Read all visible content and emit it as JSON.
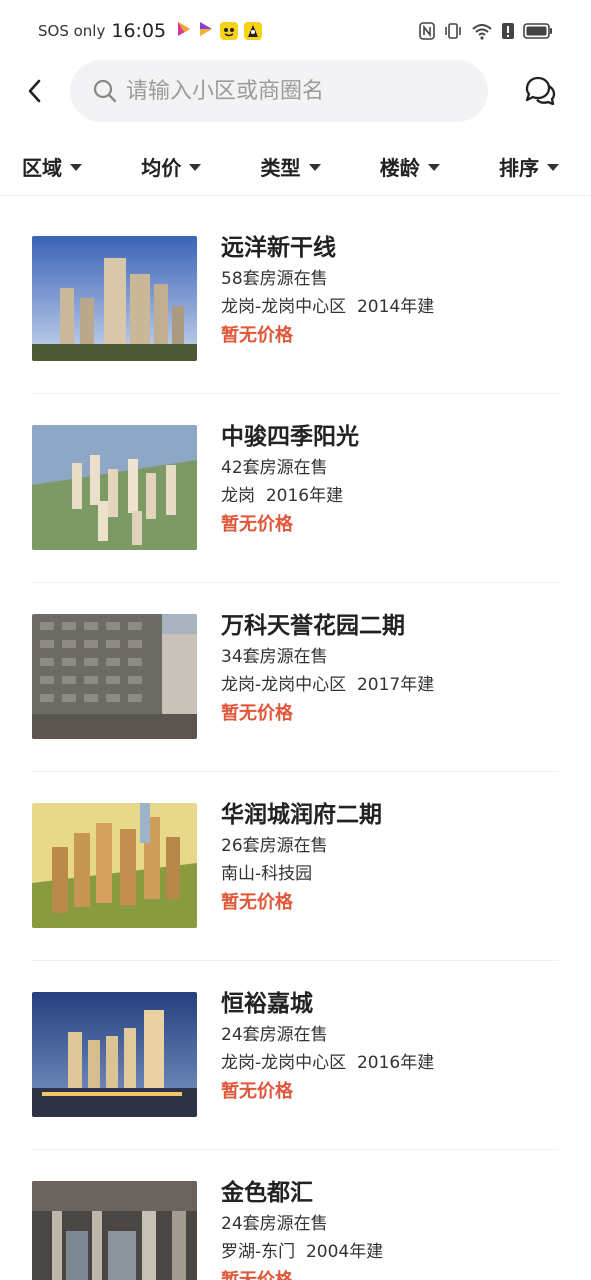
{
  "status": {
    "carrier": "SOS only",
    "time": "16:05"
  },
  "header": {
    "search_placeholder": "请输入小区或商圈名"
  },
  "filters": [
    {
      "label": "区域"
    },
    {
      "label": "均价"
    },
    {
      "label": "类型"
    },
    {
      "label": "楼龄"
    },
    {
      "label": "排序"
    }
  ],
  "listings": [
    {
      "name": "远洋新干线",
      "count": "58套房源在售",
      "location": "龙岗-龙岗中心区",
      "year": "2014年建",
      "price": "暂无价格"
    },
    {
      "name": "中骏四季阳光",
      "count": "42套房源在售",
      "location": "龙岗",
      "year": "2016年建",
      "price": "暂无价格"
    },
    {
      "name": "万科天誉花园二期",
      "count": "34套房源在售",
      "location": "龙岗-龙岗中心区",
      "year": "2017年建",
      "price": "暂无价格"
    },
    {
      "name": "华润城润府二期",
      "count": "26套房源在售",
      "location": "南山-科技园",
      "year": "",
      "price": "暂无价格"
    },
    {
      "name": "恒裕嘉城",
      "count": "24套房源在售",
      "location": "龙岗-龙岗中心区",
      "year": "2016年建",
      "price": "暂无价格"
    },
    {
      "name": "金色都汇",
      "count": "24套房源在售",
      "location": "罗湖-东门",
      "year": "2004年建",
      "price": "暂无价格"
    }
  ],
  "colors": {
    "price": "#e0573a",
    "search_bg": "#f3f3f5"
  }
}
